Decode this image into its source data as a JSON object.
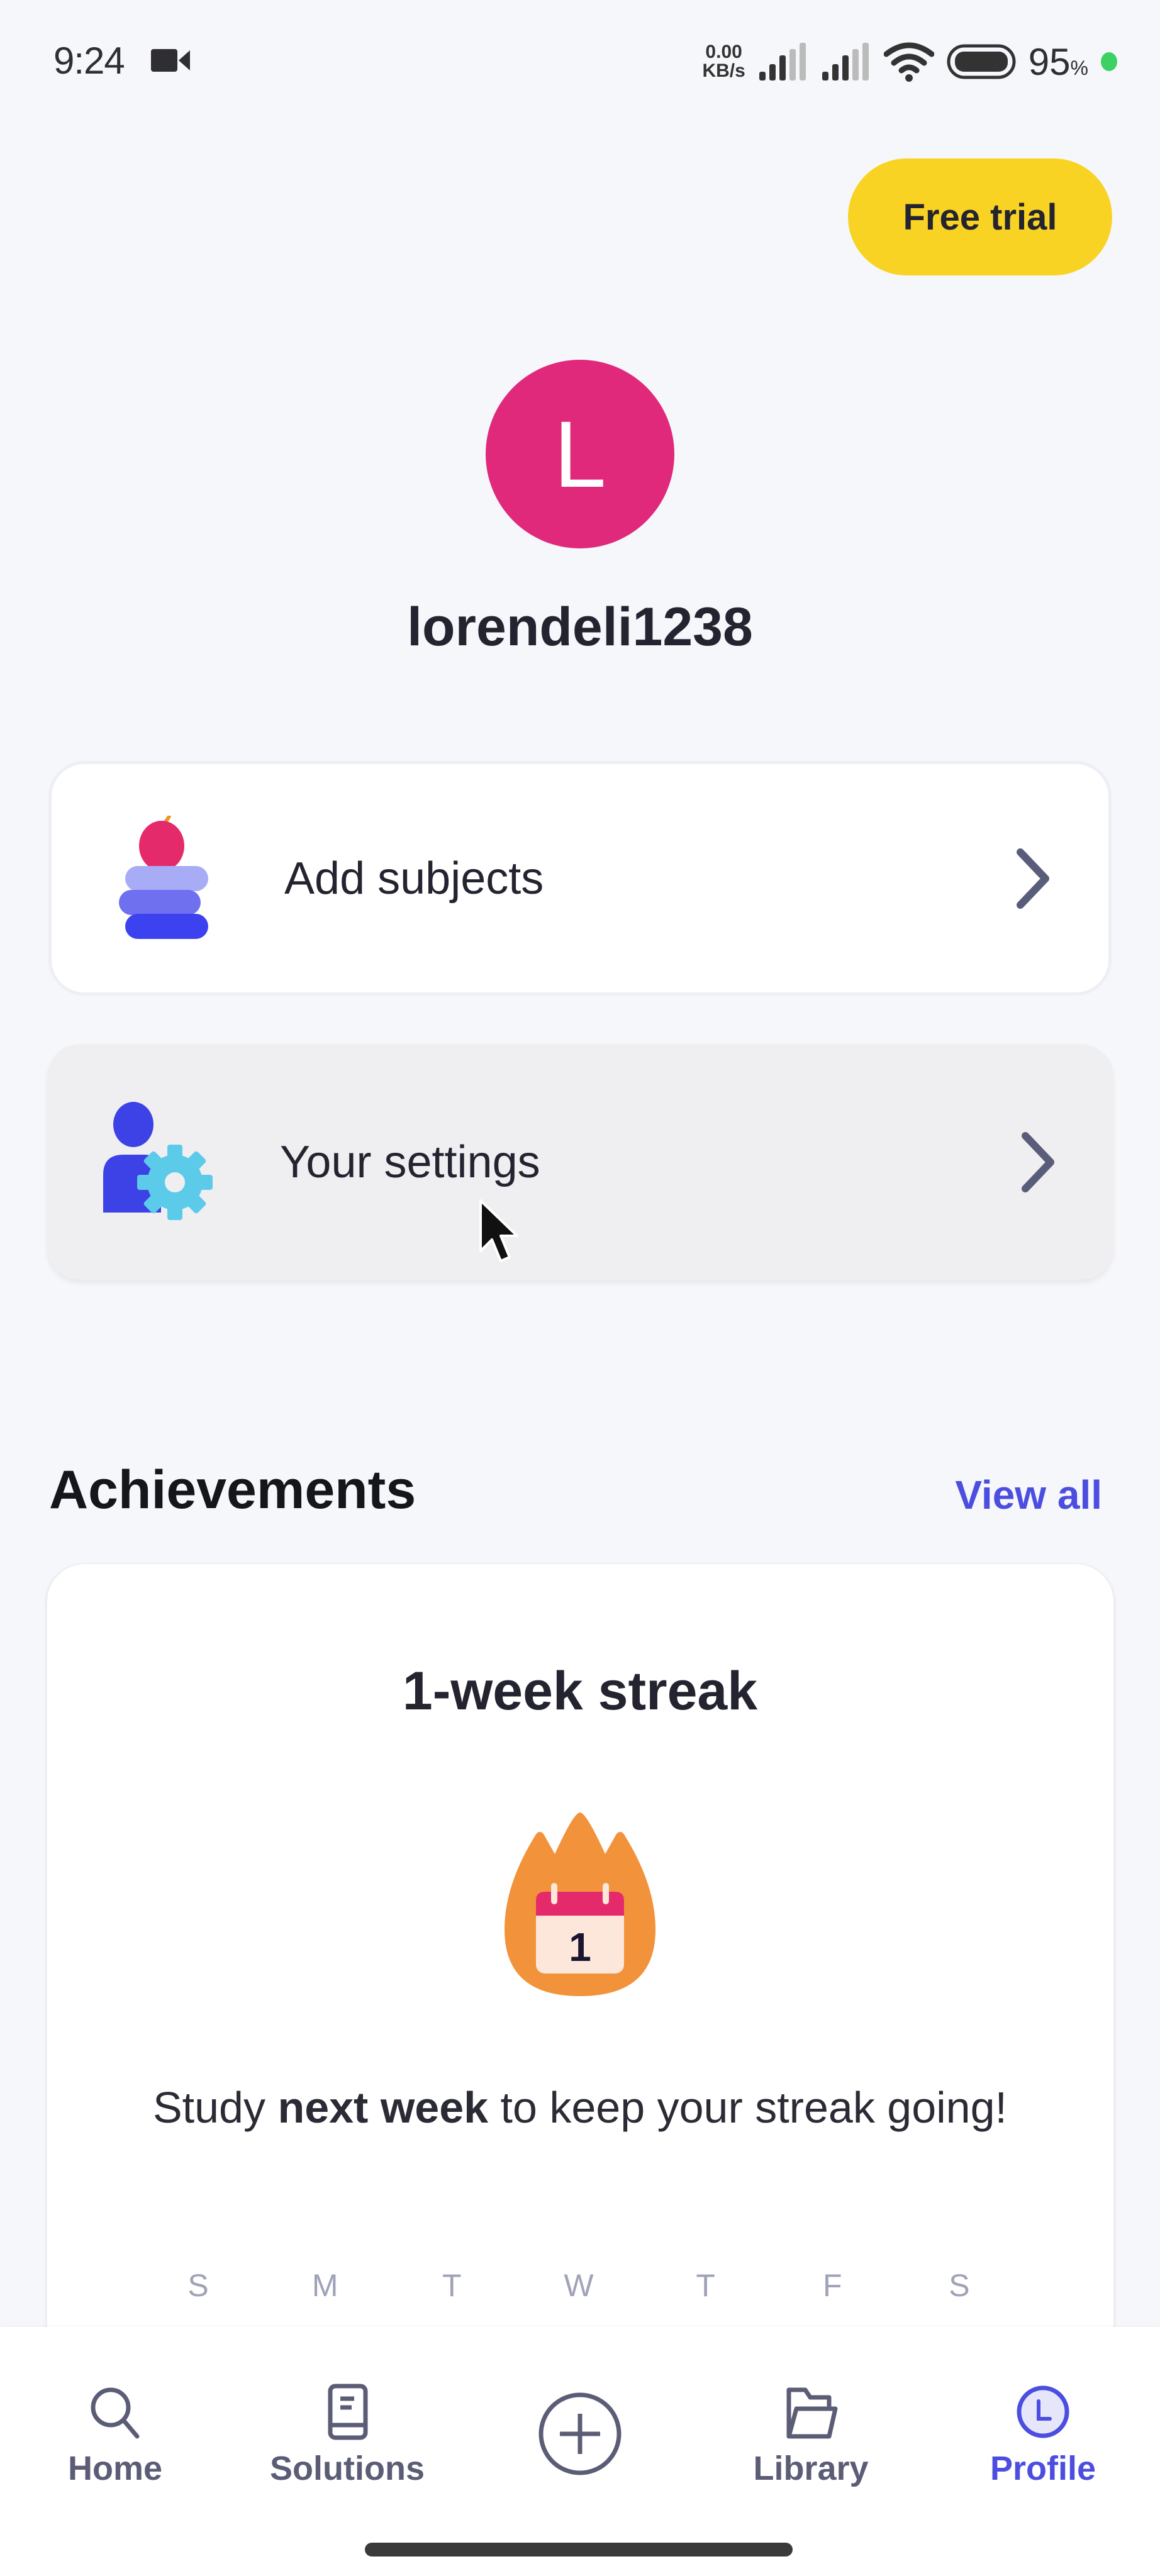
{
  "status_bar": {
    "time": "9:24",
    "net_speed_value": "0.00",
    "net_speed_unit": "KB/s",
    "battery_percent": "95",
    "battery_percent_sign": "%",
    "icons": [
      "video-camera-icon",
      "signal-icon",
      "signal-icon",
      "wifi-icon",
      "battery-icon",
      "green-dot"
    ]
  },
  "header": {
    "free_trial_label": "Free trial"
  },
  "profile": {
    "avatar_initial": "L",
    "avatar_color": "#E0297A",
    "username": "lorendeli1238"
  },
  "menu": [
    {
      "label": "Add subjects",
      "icon": "book-stack-apple-icon"
    },
    {
      "label": "Your settings",
      "icon": "user-gear-icon"
    }
  ],
  "achievements": {
    "title": "Achievements",
    "view_all_label": "View all",
    "card": {
      "title": "1-week streak",
      "badge_number": "1",
      "text_before": "Study ",
      "text_bold": "next week",
      "text_after": " to keep your streak going!",
      "weekdays": [
        "S",
        "M",
        "T",
        "W",
        "T",
        "F",
        "S"
      ]
    }
  },
  "bottom_nav": {
    "items": [
      {
        "label": "Home",
        "icon": "search-icon",
        "active": false
      },
      {
        "label": "Solutions",
        "icon": "book-icon",
        "active": false
      },
      {
        "label": "",
        "icon": "plus-circle-icon",
        "active": false
      },
      {
        "label": "Library",
        "icon": "folder-icon",
        "active": false
      },
      {
        "label": "Profile",
        "icon": "profile-avatar-icon",
        "active": true
      }
    ]
  },
  "colors": {
    "background": "#F6F7FB",
    "accent": "#4C4EE0",
    "free_trial": "#F9D324",
    "text": "#23242F",
    "streak_orange": "#F2923A",
    "calendar_red": "#E52A6C"
  }
}
